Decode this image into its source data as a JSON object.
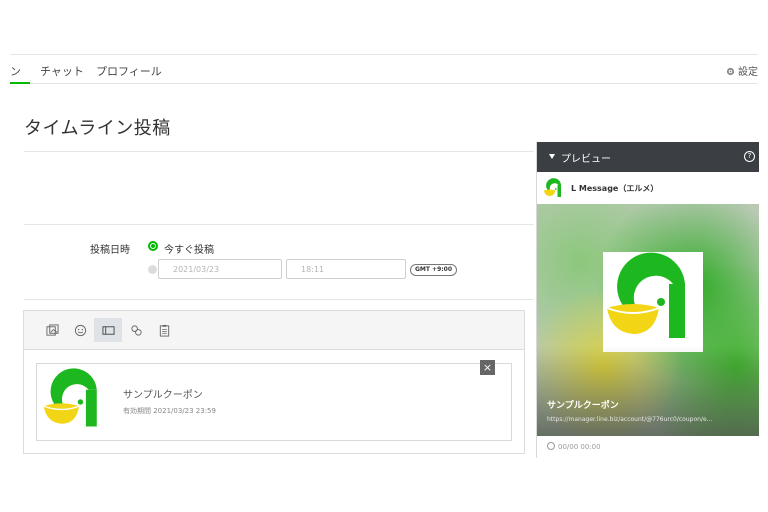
{
  "nav": {
    "tabs": [
      {
        "label": "ン"
      },
      {
        "label": "チャット"
      },
      {
        "label": "プロフィール"
      }
    ],
    "settings_label": "設定"
  },
  "page": {
    "title": "タイムライン投稿"
  },
  "schedule": {
    "label": "投稿日時",
    "now_option": "今すぐ投稿",
    "date_placeholder": "2021/03/23",
    "time_placeholder": "18:11",
    "timezone": "GMT +9:00"
  },
  "editor": {
    "toolbar": [
      {
        "icon": "image-icon"
      },
      {
        "icon": "emoji-icon"
      },
      {
        "icon": "coupon-icon"
      },
      {
        "icon": "link-icon"
      },
      {
        "icon": "clipboard-icon"
      }
    ],
    "card": {
      "title": "サンプルクーポン",
      "subtitle": "有効期間 2021/03/23 23:59"
    },
    "close_label": "×"
  },
  "preview": {
    "header_title": "プレビュー",
    "help_label": "?",
    "account_name": "L Message（エルメ）",
    "coupon_title": "サンプルクーポン",
    "coupon_url": "https://manager.line.biz/account/@776urc0/coupon/e...",
    "date": "00/00 00:00"
  },
  "colors": {
    "accent": "#00b900",
    "logo_green": "#1db820",
    "logo_yellow": "#f2d515",
    "preview_header": "#3b3f44"
  }
}
